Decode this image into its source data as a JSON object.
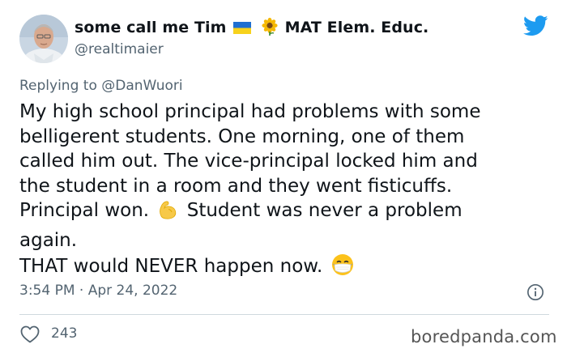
{
  "author": {
    "display_name": "some call me Tim",
    "display_name_suffix": "MAT Elem. Educ.",
    "handle": "@realtimaier"
  },
  "reply": {
    "prefix": "Replying to",
    "to": "@DanWuori"
  },
  "tweet": {
    "lines": [
      "My high school principal had problems with some",
      "belligerent students. One morning, one of them",
      "called him out. The vice-principal locked him and",
      "the student in a room and they went fisticuffs.",
      "Principal won.",
      "Student was never a problem",
      "again.",
      "THAT would NEVER happen now."
    ],
    "emojis": [
      "flexed-biceps-icon",
      "face-with-medical-mask-icon"
    ]
  },
  "meta": {
    "time": "3:54 PM",
    "separator": "·",
    "date": "Apr 24, 2022"
  },
  "engagement": {
    "likes": "243"
  },
  "watermark": "boredpanda.com",
  "colors": {
    "twitter_blue": "#1d9bf0",
    "secondary_text": "#536471",
    "primary_text": "#0f1419",
    "divider": "#cfd9de"
  }
}
